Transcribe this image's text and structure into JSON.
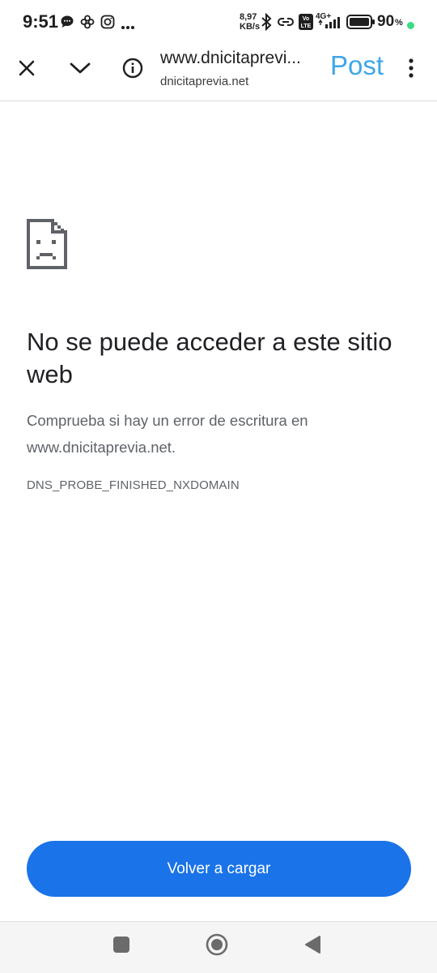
{
  "status_bar": {
    "time": "9:51",
    "net_speed_value": "8,97",
    "net_speed_unit": "KB/s",
    "network_type": "4G+",
    "volte": "Vo LTE",
    "battery_percent": "90",
    "battery_suffix": "%",
    "icons": [
      "chat-bubble-icon",
      "pinwheel-icon",
      "instagram-icon",
      "more-dots-icon",
      "bluetooth-icon",
      "link-icon",
      "volte-icon",
      "signal-icon",
      "battery-icon",
      "dot-icon"
    ],
    "accent_dot_color": "#3ddc84"
  },
  "toolbar": {
    "url_title": "www.dnicitaprevi...",
    "url_domain": "dnicitaprevia.net",
    "post_label": "Post",
    "post_color": "#3ea6e8",
    "icons": [
      "close-icon",
      "chevron-down-icon",
      "info-icon",
      "more-vert-icon"
    ]
  },
  "error_page": {
    "icon": "sad-document-icon",
    "title": "No se puede acceder a este sitio web",
    "description": "Comprueba si hay un error de escritura en www.dnicitaprevia.net.",
    "code": "DNS_PROBE_FINISHED_NXDOMAIN",
    "reload_label": "Volver a cargar",
    "reload_color": "#1a73e8"
  },
  "nav_bar": {
    "icons": [
      "recents-square-icon",
      "home-circle-icon",
      "back-triangle-icon"
    ]
  }
}
